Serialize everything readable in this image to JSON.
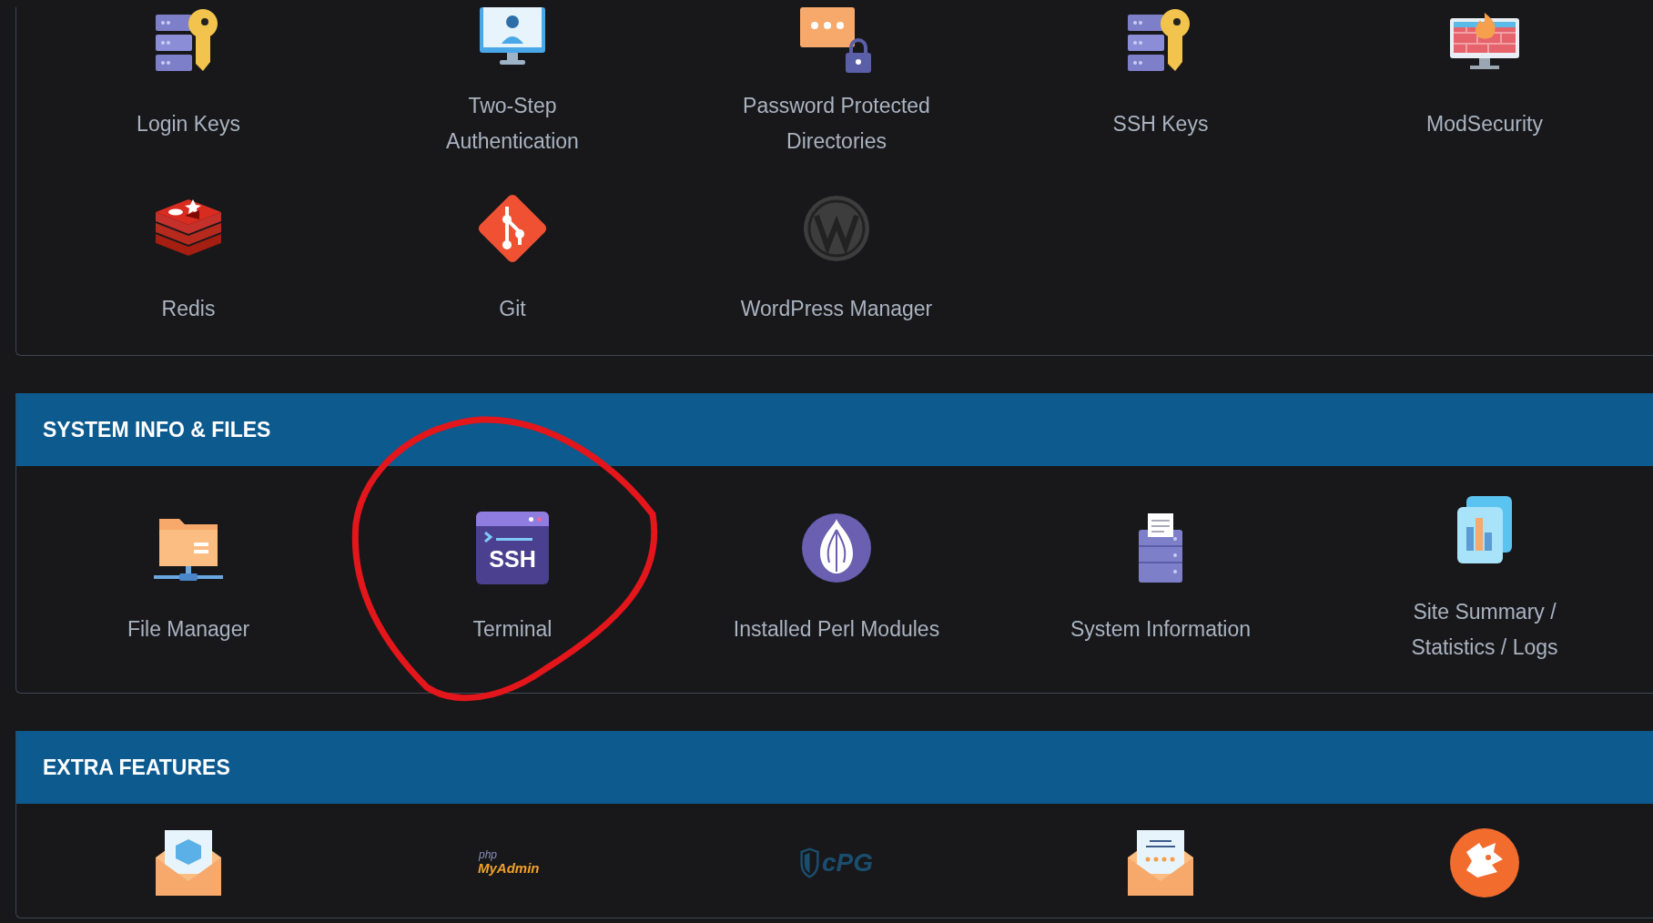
{
  "sections": [
    {
      "rows": [
        [
          {
            "label": "Login Keys"
          },
          {
            "label": "Two-Step Authentication"
          },
          {
            "label": "Password Protected Directories"
          },
          {
            "label": "SSH Keys"
          },
          {
            "label": "ModSecurity"
          }
        ],
        [
          {
            "label": "Redis"
          },
          {
            "label": "Git"
          },
          {
            "label": "WordPress Manager"
          }
        ]
      ]
    },
    {
      "title": "SYSTEM INFO & FILES",
      "rows": [
        [
          {
            "label": "File Manager",
            "circled": false
          },
          {
            "label": "Terminal",
            "logo_text": "SSH",
            "circled": true
          },
          {
            "label": "Installed Perl Modules",
            "circled": false
          },
          {
            "label": "System Information",
            "circled": false
          },
          {
            "label": "Site Summary / Statistics / Logs",
            "circled": false
          }
        ]
      ]
    },
    {
      "title": "EXTRA FEATURES",
      "rows": [
        [
          {},
          {
            "logo_small": "php",
            "logo_big": "MyAdmin"
          },
          {
            "logo_big": "cPG"
          },
          {},
          {}
        ]
      ]
    }
  ]
}
